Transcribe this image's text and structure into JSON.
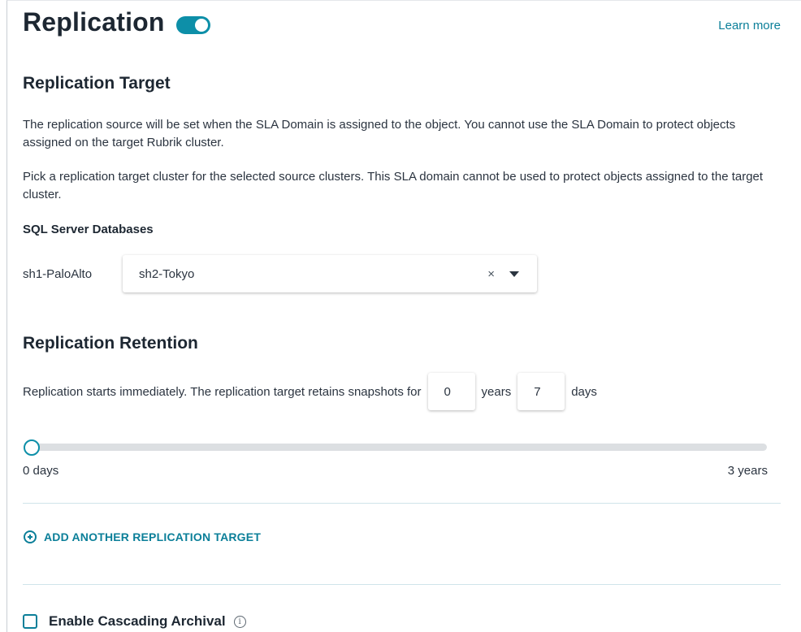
{
  "header": {
    "title": "Replication",
    "learn_more": "Learn more",
    "toggle_on": true
  },
  "target": {
    "heading": "Replication Target",
    "para1": "The replication source will be set when the SLA Domain is assigned to the object. You cannot use the SLA Domain to protect objects assigned on the target Rubrik cluster.",
    "para2": "Pick a replication target cluster for the selected source clusters. This SLA domain cannot be used to protect objects assigned to the target cluster.",
    "section_label": "SQL Server Databases",
    "source_cluster": "sh1-PaloAlto",
    "selected_target": "sh2-Tokyo",
    "clear_symbol": "×"
  },
  "retention": {
    "heading": "Replication Retention",
    "text": "Replication starts immediately. The replication target retains snapshots for",
    "years_value": "0",
    "years_label": "years",
    "days_value": "7",
    "days_label": "days",
    "slider_min_label": "0 days",
    "slider_max_label": "3 years",
    "slider_fraction": 0.0
  },
  "add_target": {
    "label": "ADD ANOTHER REPLICATION TARGET"
  },
  "cascading": {
    "label": "Enable Cascading Archival",
    "checked": false
  },
  "colors": {
    "accent": "#0d8fa8",
    "link": "#0b7f99"
  }
}
